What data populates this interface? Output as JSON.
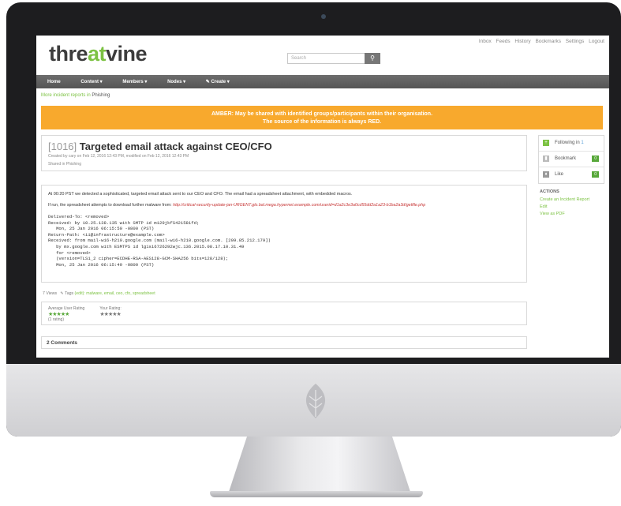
{
  "header": {
    "logo_part1": "thre",
    "logo_part2": "at",
    "logo_part3": "vine",
    "top_links": [
      "Inbox",
      "Feeds",
      "History",
      "Bookmarks",
      "Settings",
      "Logout"
    ],
    "search_placeholder": "Search"
  },
  "nav": [
    "Home",
    "Content ▾",
    "Members ▾",
    "Nodes ▾",
    "✎ Create ▾"
  ],
  "breadcrumb": {
    "text": "More incident reports in",
    "category": "Phishing"
  },
  "amber_banner": {
    "line1": "AMBER: May be shared with identified groups/participants within their organisation.",
    "line2": "The source of the information is always RED."
  },
  "incident": {
    "id": "[1016]",
    "title": "Targeted email attack against CEO/CFO",
    "created": "Created by cary on Feb 12, 2016 12:43 PM, modified on Feb 12, 2016 12:43 PM",
    "shared": "Shared in Phishing",
    "description": "At 00:20 PST we detected a sophisticated, targeted email attack sent to our CEO and CFO. The email had a spreadsheet attachment, with embedded macros.",
    "link_text": "If run, the spreadsheet attempts to download further malware from:",
    "link_url": "http://critical-security-update-jan-URGENT.glo.bal.mega.hypernet.example.com/userid=d1a2c3e3a0cd55dd2a1a23-b1ba2a3d/getfile.php",
    "headers": "Delivered-To: <removed>\nReceived: by 10.25.138.135 with SMTP id m129jkfS421581fd;\n   Mon, 25 Jan 2016 06:15:50 -0800 (PST)\nReturn-Path: <ii@infrastructure@example.com>\nReceived: from mail-wi6-h210.google.com (mail-wi6-h210.google.com. [209.85.212.179])\n   by mx.google.com with ESMTPS id lg1si6726292wjc.136.2015.08.17.10.31.49\n   for <removed>\n   (version=TLS1_2 cipher=ECDHE-RSA-AES128-GCM-SHA256 bits=128/128);\n   Mon, 25 Jan 2016 06:15:49 -0800 (PST)"
  },
  "sidebar": {
    "following": {
      "label": "Following in",
      "count": "1"
    },
    "bookmark": {
      "label": "Bookmark",
      "count": "0"
    },
    "like": {
      "label": "Like",
      "count": "0"
    },
    "actions_heading": "ACTIONS",
    "actions": [
      "Create an Incident Report",
      "Edit",
      "View as PDF"
    ]
  },
  "footer": {
    "views": "7 Views",
    "tags_label": "Tags",
    "tags_edit": "(edit):",
    "tags": "malware, email, ceo, cfo, spreadsheet",
    "avg_rating_label": "Average User Rating",
    "rating_count": "(1 rating)",
    "your_rating_label": "Your Rating:",
    "comments": "2 Comments"
  }
}
